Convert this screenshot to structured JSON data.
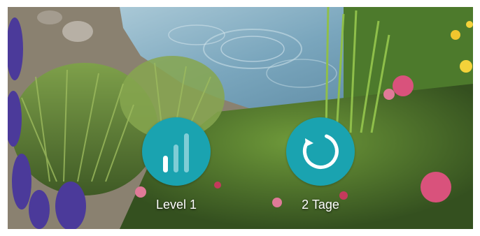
{
  "features": [
    {
      "icon": "signal-bars-icon",
      "label": "Level 1"
    },
    {
      "icon": "refresh-cycle-icon",
      "label": "2 Tage"
    }
  ],
  "colors": {
    "badge": "#1aa3b0",
    "badge_icon": "#ffffff",
    "badge_icon_muted": "#7fcdd6",
    "caption_text": "#ffffff"
  }
}
